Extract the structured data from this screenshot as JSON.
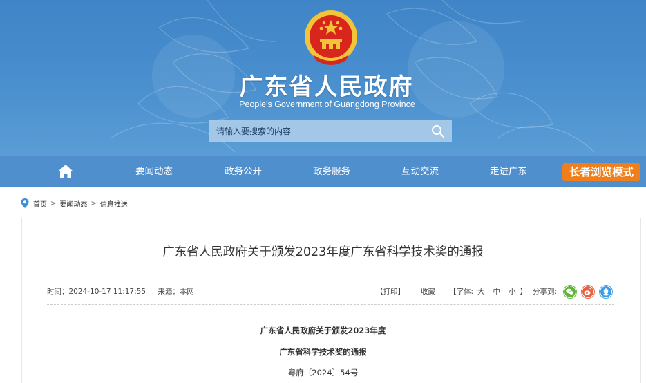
{
  "header": {
    "site_title": "广东省人民政府",
    "site_subtitle": "People's Government of Guangdong Province",
    "emblem_icon": "national-emblem-icon",
    "search": {
      "placeholder": "请输入要搜索的内容",
      "value": "",
      "icon": "search-icon"
    }
  },
  "nav": {
    "home_icon": "home-icon",
    "items": [
      {
        "label": "要闻动态"
      },
      {
        "label": "政务公开"
      },
      {
        "label": "政务服务"
      },
      {
        "label": "互动交流"
      },
      {
        "label": "走进广东"
      }
    ],
    "elder_mode_label": "长者浏览模式"
  },
  "breadcrumb": {
    "icon": "location-pin-icon",
    "items": [
      "首页",
      "要闻动态",
      "信息推送"
    ],
    "separator": ">"
  },
  "article": {
    "title": "广东省人民政府关于颁发2023年度广东省科学技术奖的通报",
    "meta": {
      "time_label": "时间：2024-10-17 11:17:55",
      "source_label": "来源：本网"
    },
    "tools": {
      "print_label": "【打印】",
      "favorite_label": "收藏",
      "font_prefix": "【字体:",
      "font_large": "大",
      "font_medium": "中",
      "font_small": "小",
      "font_suffix": "】",
      "share_label": "分享到:"
    },
    "share_icons": [
      {
        "name": "wechat-icon",
        "color": "#5fb336"
      },
      {
        "name": "weibo-icon",
        "color": "#e8603c"
      },
      {
        "name": "qq-icon",
        "color": "#3a9ee6"
      }
    ],
    "body": {
      "heading_line1": "广东省人民政府关于颁发2023年度",
      "heading_line2": "广东省科学技术奖的通报",
      "doc_number": "粤府〔2024〕54号"
    }
  },
  "colors": {
    "banner": "#4a90cf",
    "nav": "#4f8fce",
    "elder_button": "#f07f1b",
    "emblem_red": "#d8261c",
    "emblem_gold": "#f2c43a"
  }
}
